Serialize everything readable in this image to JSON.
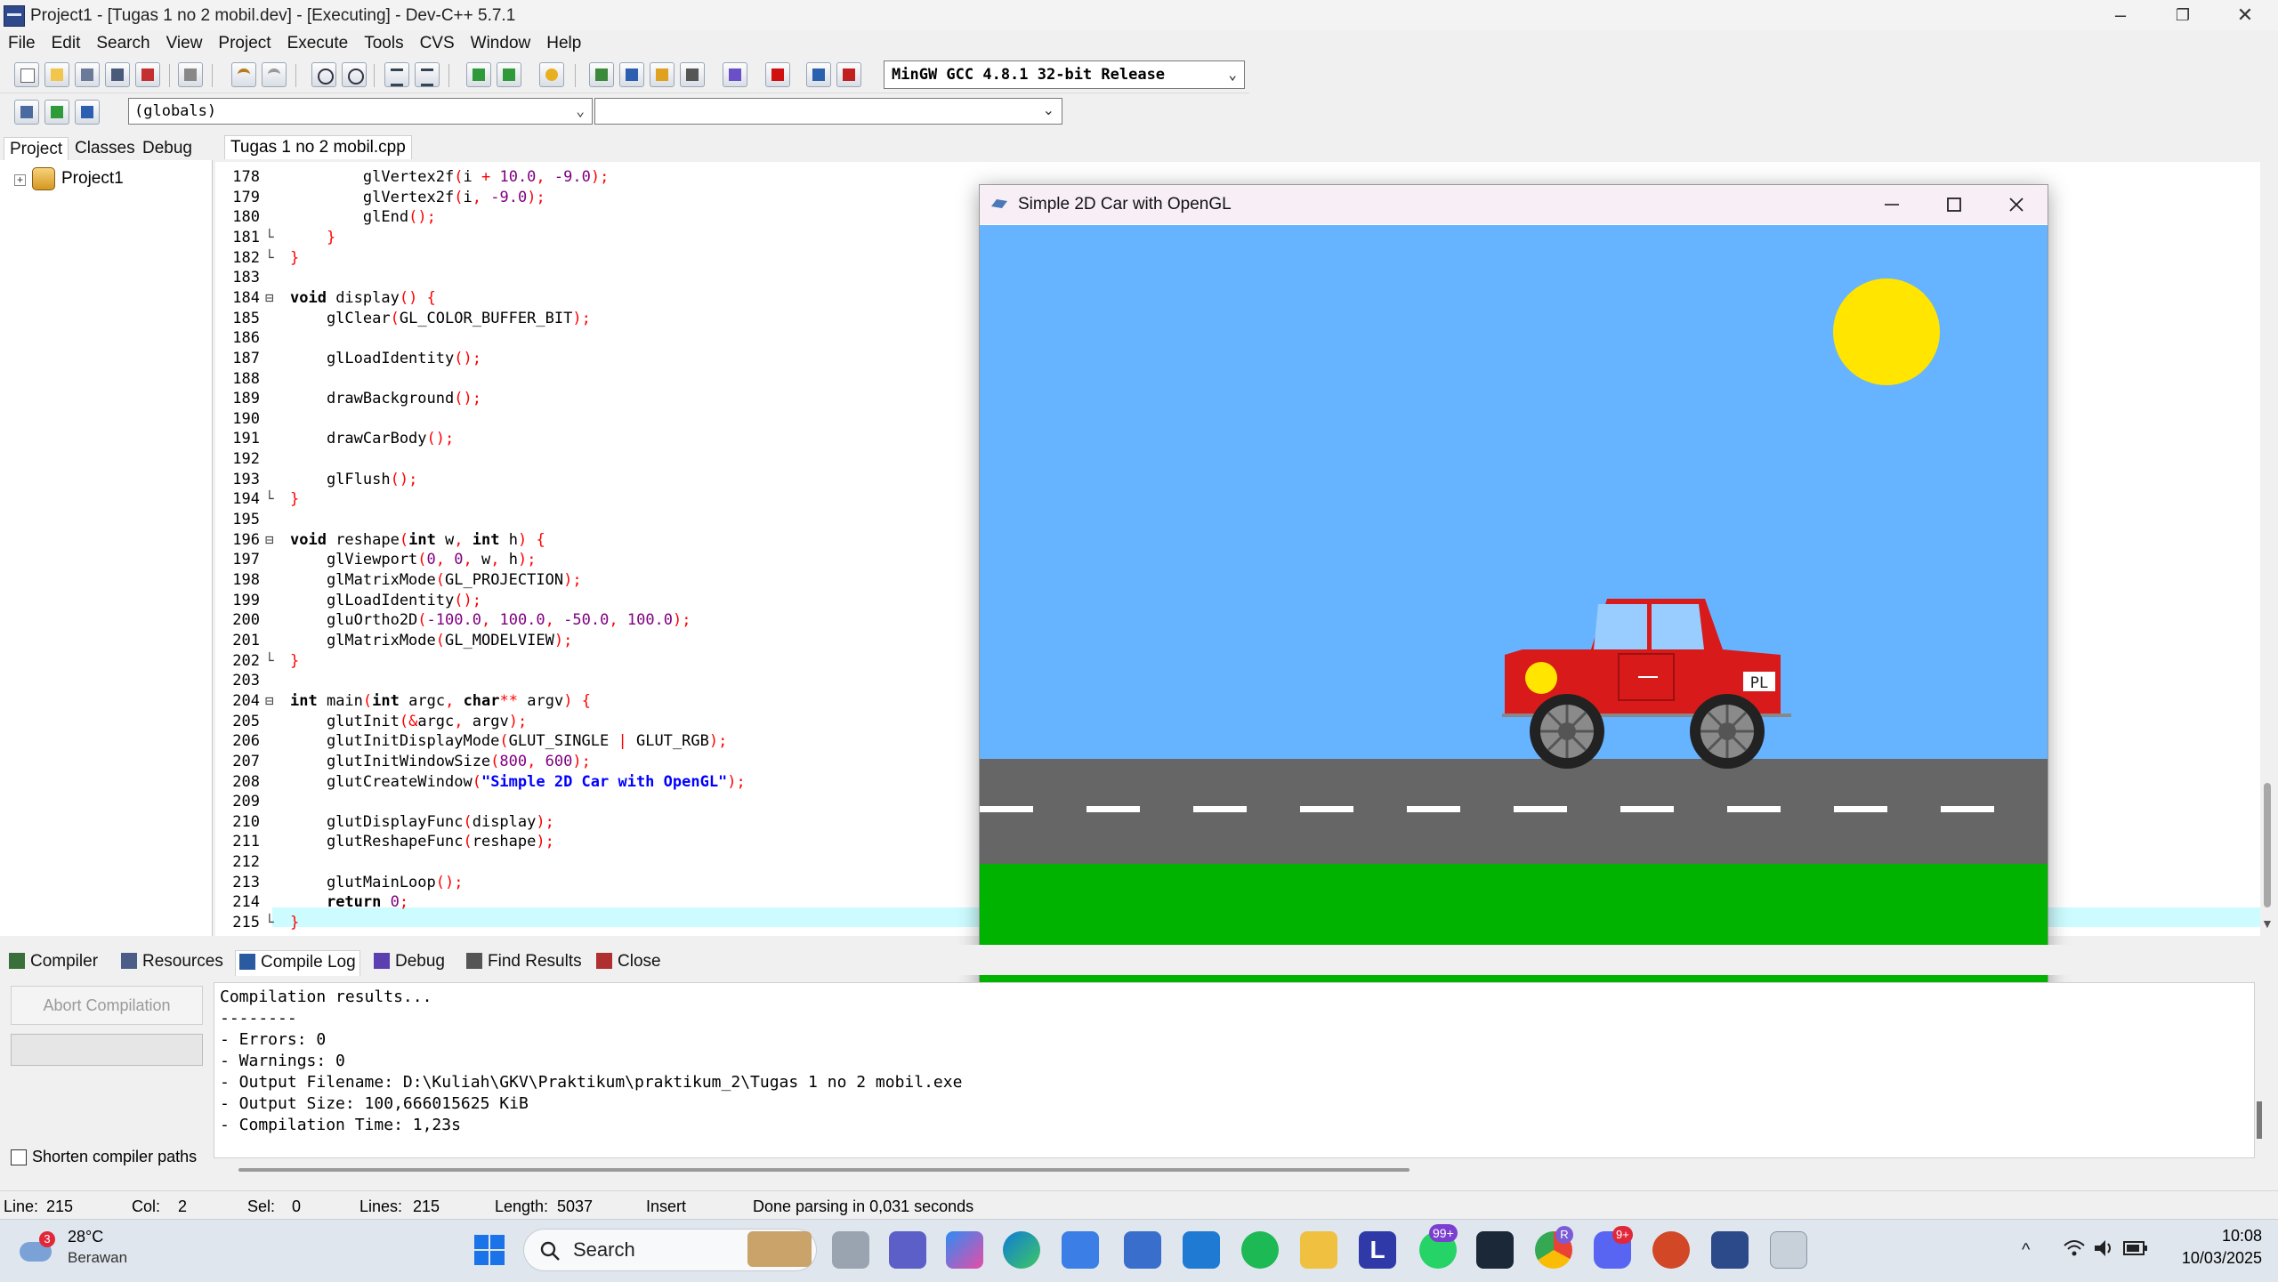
{
  "window": {
    "title": "Project1 - [Tugas 1 no 2 mobil.dev] - [Executing] - Dev-C++ 5.7.1",
    "minimize": "–",
    "maximize": "❐",
    "close": "✕"
  },
  "menu": [
    "File",
    "Edit",
    "Search",
    "View",
    "Project",
    "Execute",
    "Tools",
    "CVS",
    "Window",
    "Help"
  ],
  "toolbar": {
    "compiler": "MinGW GCC 4.8.1 32-bit Release",
    "scope": "(globals)"
  },
  "left_panel": {
    "tabs": [
      "Project",
      "Classes",
      "Debug"
    ],
    "tree_root": "Project1"
  },
  "editor": {
    "file_tab": "Tugas 1 no 2 mobil.cpp",
    "lines": [
      {
        "n": "178",
        "fold": "",
        "code": "        glVertex2f(i + 10.0, -9.0);"
      },
      {
        "n": "179",
        "fold": "",
        "code": "        glVertex2f(i, -9.0);"
      },
      {
        "n": "180",
        "fold": "",
        "code": "        glEnd();"
      },
      {
        "n": "181",
        "fold": "└",
        "code": "    }"
      },
      {
        "n": "182",
        "fold": "└",
        "code": "}"
      },
      {
        "n": "183",
        "fold": "",
        "code": ""
      },
      {
        "n": "184",
        "fold": "⊟",
        "code": "void display() {"
      },
      {
        "n": "185",
        "fold": "",
        "code": "    glClear(GL_COLOR_BUFFER_BIT);"
      },
      {
        "n": "186",
        "fold": "",
        "code": ""
      },
      {
        "n": "187",
        "fold": "",
        "code": "    glLoadIdentity();"
      },
      {
        "n": "188",
        "fold": "",
        "code": ""
      },
      {
        "n": "189",
        "fold": "",
        "code": "    drawBackground();"
      },
      {
        "n": "190",
        "fold": "",
        "code": ""
      },
      {
        "n": "191",
        "fold": "",
        "code": "    drawCarBody();"
      },
      {
        "n": "192",
        "fold": "",
        "code": ""
      },
      {
        "n": "193",
        "fold": "",
        "code": "    glFlush();"
      },
      {
        "n": "194",
        "fold": "└",
        "code": "}"
      },
      {
        "n": "195",
        "fold": "",
        "code": ""
      },
      {
        "n": "196",
        "fold": "⊟",
        "code": "void reshape(int w, int h) {"
      },
      {
        "n": "197",
        "fold": "",
        "code": "    glViewport(0, 0, w, h);"
      },
      {
        "n": "198",
        "fold": "",
        "code": "    glMatrixMode(GL_PROJECTION);"
      },
      {
        "n": "199",
        "fold": "",
        "code": "    glLoadIdentity();"
      },
      {
        "n": "200",
        "fold": "",
        "code": "    gluOrtho2D(-100.0, 100.0, -50.0, 100.0);"
      },
      {
        "n": "201",
        "fold": "",
        "code": "    glMatrixMode(GL_MODELVIEW);"
      },
      {
        "n": "202",
        "fold": "└",
        "code": "}"
      },
      {
        "n": "203",
        "fold": "",
        "code": ""
      },
      {
        "n": "204",
        "fold": "⊟",
        "code": "int main(int argc, char** argv) {"
      },
      {
        "n": "205",
        "fold": "",
        "code": "    glutInit(&argc, argv);"
      },
      {
        "n": "206",
        "fold": "",
        "code": "    glutInitDisplayMode(GLUT_SINGLE | GLUT_RGB);"
      },
      {
        "n": "207",
        "fold": "",
        "code": "    glutInitWindowSize(800, 600);"
      },
      {
        "n": "208",
        "fold": "",
        "code": "    glutCreateWindow(\"Simple 2D Car with OpenGL\");"
      },
      {
        "n": "209",
        "fold": "",
        "code": ""
      },
      {
        "n": "210",
        "fold": "",
        "code": "    glutDisplayFunc(display);"
      },
      {
        "n": "211",
        "fold": "",
        "code": "    glutReshapeFunc(reshape);"
      },
      {
        "n": "212",
        "fold": "",
        "code": ""
      },
      {
        "n": "213",
        "fold": "",
        "code": "    glutMainLoop();"
      },
      {
        "n": "214",
        "fold": "",
        "code": "    return 0;"
      },
      {
        "n": "215",
        "fold": "└",
        "code": "}"
      }
    ]
  },
  "bottom": {
    "tabs": [
      "Compiler",
      "Resources",
      "Compile Log",
      "Debug",
      "Find Results",
      "Close"
    ],
    "abort_label": "Abort Compilation",
    "shorten_label": "Shorten compiler paths",
    "log": [
      "Compilation results...",
      "--------",
      "- Errors: 0",
      "- Warnings: 0",
      "- Output Filename: D:\\Kuliah\\GKV\\Praktikum\\praktikum_2\\Tugas 1 no 2 mobil.exe",
      "- Output Size: 100,666015625 KiB",
      "- Compilation Time: 1,23s"
    ]
  },
  "status": {
    "line_label": "Line:",
    "line": "215",
    "col_label": "Col:",
    "col": "2",
    "sel_label": "Sel:",
    "sel": "0",
    "lines_label": "Lines:",
    "lines": "215",
    "length_label": "Length:",
    "length": "5037",
    "mode": "Insert",
    "message": "Done parsing in 0,031 seconds"
  },
  "taskbar": {
    "weather_temp": "28°C",
    "weather_desc": "Berawan",
    "weather_badge": "3",
    "search": "Search",
    "whatsapp_badge": "99+",
    "discord_badge": "9+",
    "chrome_badge": "R",
    "time": "10:08",
    "date": "10/03/2025"
  },
  "gl_window": {
    "title": "Simple 2D Car with OpenGL",
    "plate": "PL",
    "colors": {
      "sky": "#66b3ff",
      "sun": "#ffe500",
      "road": "#666666",
      "grass": "#00b300",
      "car": "#d91a1a",
      "glass": "#99ccff"
    }
  }
}
